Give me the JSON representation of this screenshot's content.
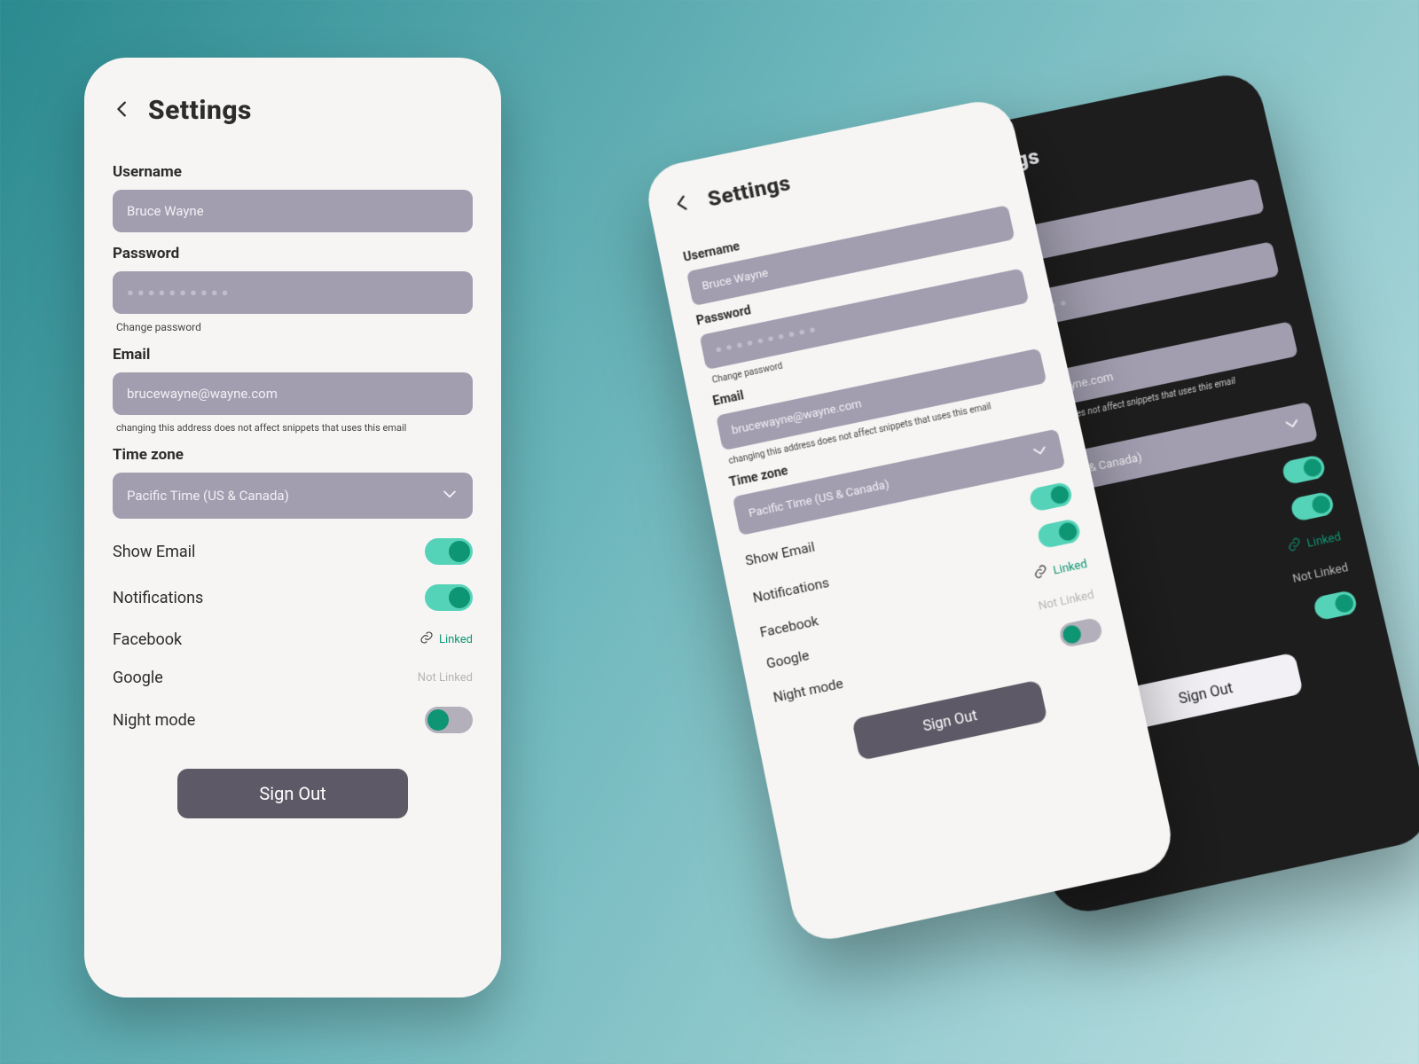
{
  "header": {
    "title": "Settings"
  },
  "fields": {
    "username": {
      "label": "Username",
      "value": "Bruce Wayne"
    },
    "password": {
      "label": "Password",
      "masked_value": "●●●●●●●●●●",
      "change_link": "Change password"
    },
    "email": {
      "label": "Email",
      "value": "brucewayne@wayne.com",
      "helper": "changing this address does not affect snippets that uses this email"
    },
    "timezone": {
      "label": "Time zone",
      "value": "Pacific Time (US & Canada)"
    }
  },
  "options": {
    "show_email": {
      "label": "Show Email",
      "type": "toggle",
      "state": "on"
    },
    "notifications": {
      "label": "Notifications",
      "type": "toggle",
      "state": "on"
    },
    "facebook": {
      "label": "Facebook",
      "type": "link",
      "linked": true,
      "text": "Linked"
    },
    "google": {
      "label": "Google",
      "type": "link",
      "linked": false,
      "text": "Not Linked"
    },
    "night_mode": {
      "label": "Night mode",
      "type": "toggle",
      "state": "off-teal"
    }
  },
  "signout": {
    "label": "Sign Out"
  },
  "colors": {
    "accent_teal": "#0e9573",
    "toggle_track_on": "#55d3b8",
    "input_fill": "#a29eb0",
    "button_fill": "#5d5966"
  }
}
